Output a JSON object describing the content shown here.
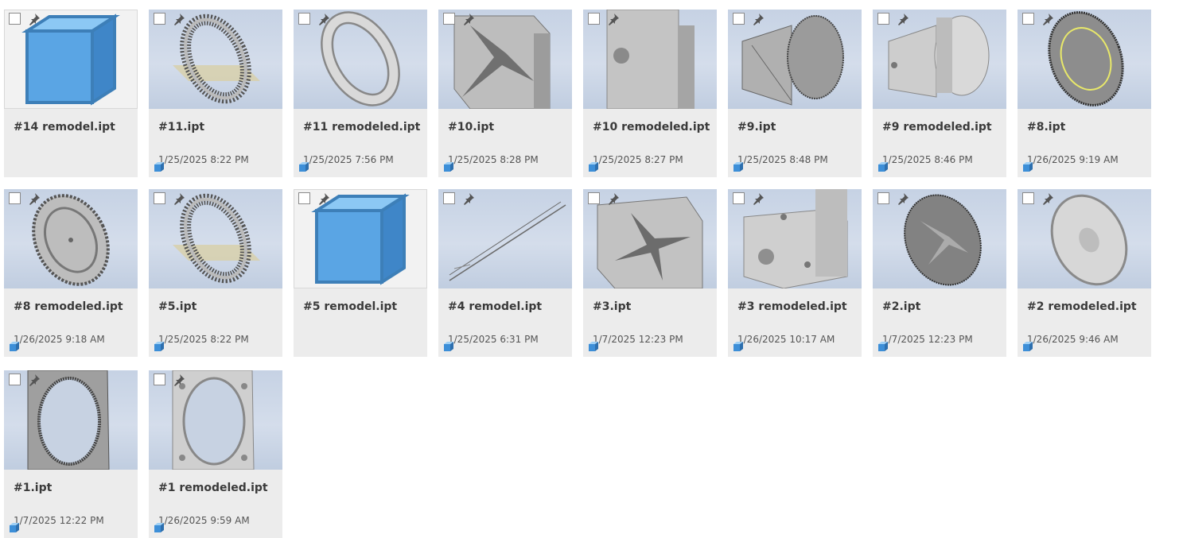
{
  "files": [
    {
      "name": "#14 remodel.ipt",
      "date": "",
      "art": "cube"
    },
    {
      "name": "#11.ipt",
      "date": "1/25/2025 8:22 PM",
      "art": "ring-mesh"
    },
    {
      "name": "#11 remodeled.ipt",
      "date": "1/25/2025 7:56 PM",
      "art": "ring"
    },
    {
      "name": "#10.ipt",
      "date": "1/25/2025 8:28 PM",
      "art": "block-star"
    },
    {
      "name": "#10 remodeled.ipt",
      "date": "1/25/2025 8:27 PM",
      "art": "block-hole"
    },
    {
      "name": "#9.ipt",
      "date": "1/25/2025 8:48 PM",
      "art": "cylinder-mesh"
    },
    {
      "name": "#9 remodeled.ipt",
      "date": "1/25/2025 8:46 PM",
      "art": "cylinder"
    },
    {
      "name": "#8.ipt",
      "date": "1/26/2025 9:19 AM",
      "art": "disc-mesh-yellow"
    },
    {
      "name": "#8 remodeled.ipt",
      "date": "1/26/2025 9:18 AM",
      "art": "disc-gear"
    },
    {
      "name": "#5.ipt",
      "date": "1/25/2025 8:22 PM",
      "art": "ring-mesh"
    },
    {
      "name": "#5 remodel.ipt",
      "date": "",
      "art": "cube"
    },
    {
      "name": "#4 remodel.ipt",
      "date": "1/25/2025 6:31 PM",
      "art": "line"
    },
    {
      "name": "#3.ipt",
      "date": "1/7/2025 12:23 PM",
      "art": "cube-star"
    },
    {
      "name": "#3 remodeled.ipt",
      "date": "1/26/2025 10:17 AM",
      "art": "block-holes"
    },
    {
      "name": "#2.ipt",
      "date": "1/7/2025 12:23 PM",
      "art": "disc-mesh"
    },
    {
      "name": "#2 remodeled.ipt",
      "date": "1/26/2025 9:46 AM",
      "art": "disc"
    },
    {
      "name": "#1.ipt",
      "date": "1/7/2025 12:22 PM",
      "art": "frame-mesh"
    },
    {
      "name": "#1 remodeled.ipt",
      "date": "1/26/2025 9:59 AM",
      "art": "frame"
    }
  ],
  "icons": {
    "checkbox": "checkbox-icon",
    "pin": "pin-icon",
    "part": "part-file-icon"
  },
  "colors": {
    "card_bg": "#ececec",
    "viewport_top": "#c6d2e4",
    "viewport_bottom": "#c0cde0",
    "cube_blue": "#6aaee8",
    "name_text": "#3a3a3a",
    "date_text": "#555555"
  }
}
